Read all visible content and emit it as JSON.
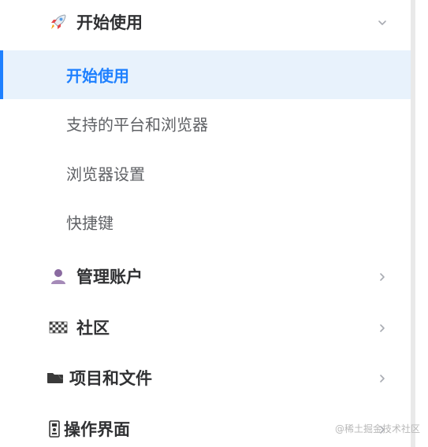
{
  "nav": {
    "groups": [
      {
        "label": "开始使用",
        "icon": "rocket-icon",
        "expanded": true,
        "chevron": "chevron-down-icon",
        "items": [
          {
            "label": "开始使用",
            "active": true
          },
          {
            "label": "支持的平台和浏览器",
            "active": false
          },
          {
            "label": "浏览器设置",
            "active": false
          },
          {
            "label": "快捷键",
            "active": false
          }
        ]
      },
      {
        "label": "管理账户",
        "icon": "user-icon",
        "expanded": false,
        "chevron": "chevron-right-icon"
      },
      {
        "label": "社区",
        "icon": "checkered-flag-icon",
        "expanded": false,
        "chevron": "chevron-right-icon"
      },
      {
        "label": "项目和文件",
        "icon": "folder-icon",
        "expanded": false,
        "chevron": "chevron-right-icon"
      },
      {
        "label": "操作界面",
        "icon": "control-panel-icon",
        "expanded": false,
        "chevron": "chevron-right-icon"
      }
    ]
  },
  "watermark": "@稀土掘金技术社区",
  "colors": {
    "accent": "#1e80ff",
    "active_bg": "#e8f2fc",
    "group_text": "#303133",
    "item_text": "#606266",
    "chevron": "#a8abb2"
  }
}
